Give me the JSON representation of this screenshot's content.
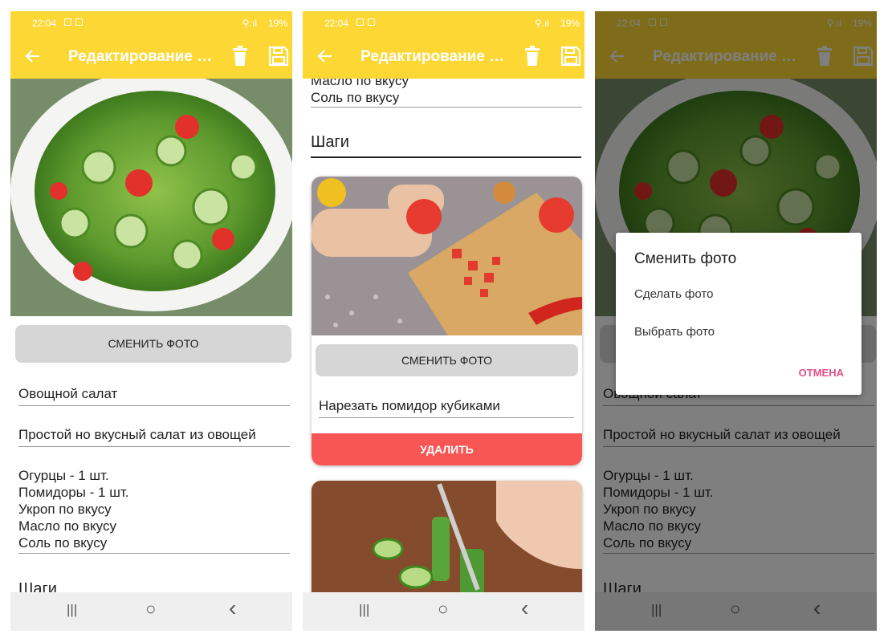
{
  "status": {
    "time": "22:04",
    "battery": "19%"
  },
  "appbar": {
    "title": "Редактирование рецепта",
    "back_icon": "arrow-left-icon",
    "delete_icon": "trash-icon",
    "save_icon": "save-icon"
  },
  "colors": {
    "primary": "#fdd835",
    "danger": "#f85555",
    "accent": "#e04f8a",
    "button_gray": "#d6d6d6"
  },
  "recipe": {
    "change_photo_label": "СМЕНИТЬ ФОТО",
    "name": "Овощной салат",
    "description": "Простой но вкусный салат из овощей",
    "ingredients": [
      "Огурцы - 1 шт.",
      "Помидоры - 1 шт.",
      "Укроп по вкусу",
      "Масло по вкусу",
      "Соль по вкусу"
    ],
    "steps_header": "Шаги"
  },
  "step1": {
    "change_photo_label": "СМЕНИТЬ ФОТО",
    "text": "Нарезать помидор кубиками",
    "delete_label": "УДАЛИТЬ"
  },
  "dialog": {
    "title": "Сменить фото",
    "option_take": "Сделать фото",
    "option_choose": "Выбрать фото",
    "cancel_label": "ОТМЕНА"
  },
  "navbar": {
    "recents": "|||",
    "home": "○",
    "back": "‹"
  }
}
